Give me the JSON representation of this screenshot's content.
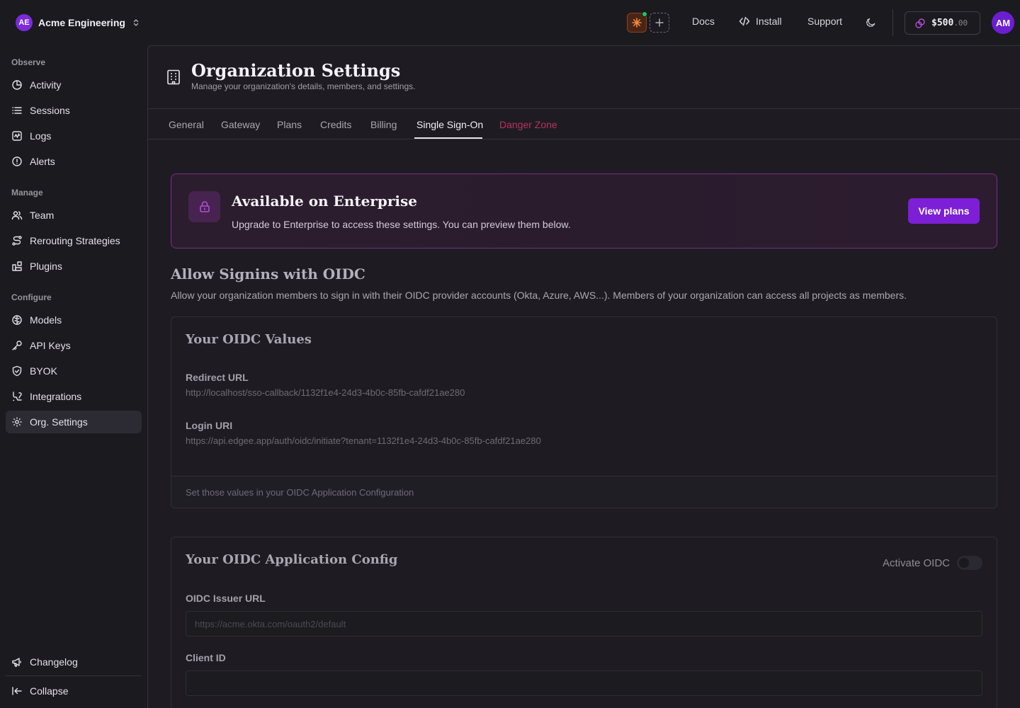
{
  "org": {
    "initials": "AE",
    "name": "Acme Engineering"
  },
  "top": {
    "docs": "Docs",
    "install": "Install",
    "support": "Support",
    "credits_whole": "$500",
    "credits_cents": ".00",
    "user_initials": "AM"
  },
  "sidebar": {
    "sections": {
      "observe": "Observe",
      "manage": "Manage",
      "configure": "Configure"
    },
    "items": {
      "activity": "Activity",
      "sessions": "Sessions",
      "logs": "Logs",
      "alerts": "Alerts",
      "team": "Team",
      "rerouting": "Rerouting Strategies",
      "plugins": "Plugins",
      "models": "Models",
      "api_keys": "API Keys",
      "byok": "BYOK",
      "integrations": "Integrations",
      "org_settings": "Org. Settings",
      "changelog": "Changelog",
      "collapse": "Collapse"
    }
  },
  "page": {
    "title": "Organization Settings",
    "subtitle": "Manage your organization's details, members, and settings."
  },
  "tabs": {
    "general": "General",
    "gateway": "Gateway",
    "plans": "Plans",
    "credits": "Credits",
    "billing": "Billing",
    "sso": "Single Sign-On",
    "danger": "Danger Zone"
  },
  "banner": {
    "title": "Available on Enterprise",
    "description": "Upgrade to Enterprise to access these settings. You can preview them below.",
    "button": "View plans"
  },
  "oidc": {
    "title": "Allow Signins with OIDC",
    "description": "Allow your organization members to sign in with their OIDC provider accounts (Okta, Azure, AWS...). Members of your organization can access all projects as members.",
    "values_card": {
      "title": "Your OIDC Values",
      "redirect_label": "Redirect URL",
      "redirect_value": "http://localhost/sso-callback/1132f1e4-24d3-4b0c-85fb-cafdf21ae280",
      "login_label": "Login URI",
      "login_value": "https://api.edgee.app/auth/oidc/initiate?tenant=1132f1e4-24d3-4b0c-85fb-cafdf21ae280",
      "footer": "Set those values in your OIDC Application Configuration"
    },
    "config_card": {
      "title": "Your OIDC Application Config",
      "activate_label": "Activate OIDC",
      "activate_on": false,
      "issuer_label": "OIDC Issuer URL",
      "issuer_placeholder": "https://acme.okta.com/oauth2/default",
      "issuer_value": "",
      "client_id_label": "Client ID",
      "client_id_value": ""
    }
  },
  "colors": {
    "accent": "#7c1fd6",
    "danger": "#b8325d",
    "banner_border": "#7c2e86"
  }
}
